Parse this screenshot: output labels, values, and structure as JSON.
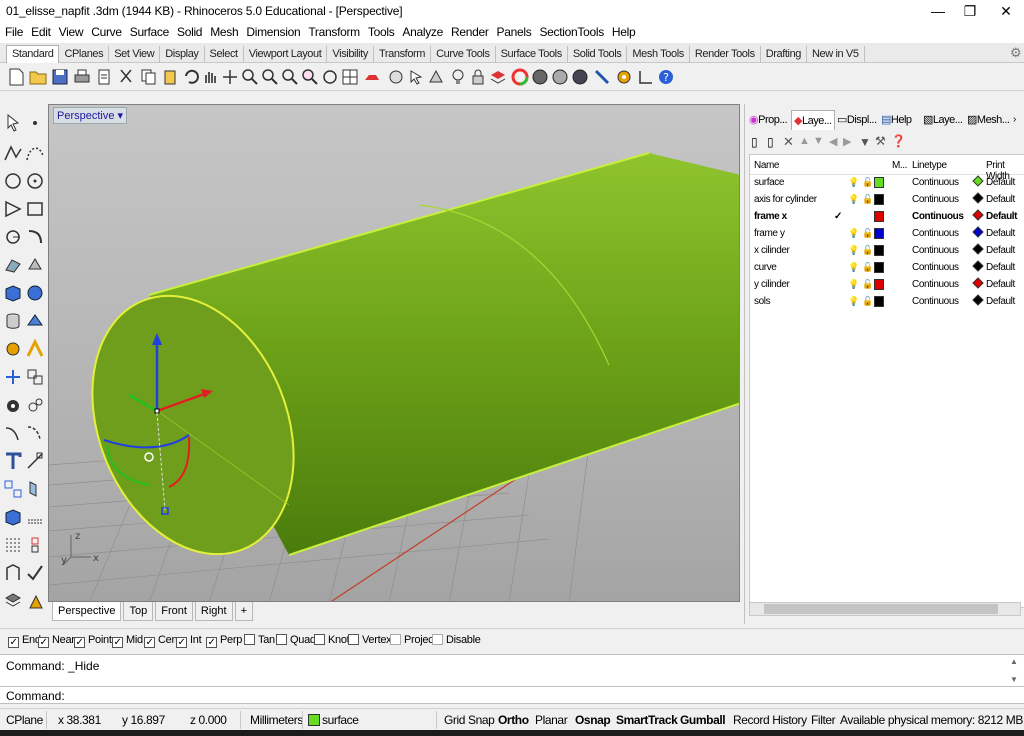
{
  "window": {
    "title": "01_elisse_napfit .3dm (1944 KB) - Rhinoceros 5.0 Educational - [Perspective]",
    "minimize": "—",
    "maximize": "❐",
    "close": "✕"
  },
  "menu": [
    "File",
    "Edit",
    "View",
    "Curve",
    "Surface",
    "Solid",
    "Mesh",
    "Dimension",
    "Transform",
    "Tools",
    "Analyze",
    "Render",
    "Panels",
    "SectionTools",
    "Help"
  ],
  "toolbar_tabs": [
    "Standard",
    "CPlanes",
    "Set View",
    "Display",
    "Select",
    "Viewport Layout",
    "Visibility",
    "Transform",
    "Curve Tools",
    "Surface Tools",
    "Solid Tools",
    "Mesh Tools",
    "Render Tools",
    "Drafting",
    "New in V5"
  ],
  "viewport": {
    "label": "Perspective",
    "label_arrow": "▾",
    "axis_x": "x",
    "axis_y": "y",
    "axis_z": "z"
  },
  "view_tabs": [
    "Perspective",
    "Top",
    "Front",
    "Right"
  ],
  "view_tab_add": "+",
  "panel": {
    "tabs": [
      "Prop...",
      "Laye...",
      "Displ...",
      "Help",
      "Laye...",
      "Mesh..."
    ],
    "columns": {
      "name": "Name",
      "material": "M...",
      "linetype": "Linetype",
      "print_width": "Print Width"
    },
    "layers": [
      {
        "name": "surface",
        "color": "#66dd22",
        "linetype": "Continuous",
        "print_width": "Default",
        "current": false
      },
      {
        "name": "axis for cylinder",
        "color": "#000000",
        "linetype": "Continuous",
        "print_width": "Default",
        "current": false
      },
      {
        "name": "frame x",
        "color": "#dd0000",
        "linetype": "Continuous",
        "print_width": "Default",
        "current": true
      },
      {
        "name": "frame y",
        "color": "#0000cc",
        "linetype": "Continuous",
        "print_width": "Default",
        "current": false
      },
      {
        "name": "x cilinder",
        "color": "#000000",
        "linetype": "Continuous",
        "print_width": "Default",
        "current": false
      },
      {
        "name": "curve",
        "color": "#000000",
        "linetype": "Continuous",
        "print_width": "Default",
        "current": false
      },
      {
        "name": "y cilinder",
        "color": "#dd0000",
        "linetype": "Continuous",
        "print_width": "Default",
        "current": false
      },
      {
        "name": "sols",
        "color": "#000000",
        "linetype": "Continuous",
        "print_width": "Default",
        "current": false
      }
    ],
    "current_mark": "✓"
  },
  "osnap": [
    {
      "label": "End",
      "checked": true
    },
    {
      "label": "Near",
      "checked": true
    },
    {
      "label": "Point",
      "checked": true
    },
    {
      "label": "Mid",
      "checked": true
    },
    {
      "label": "Cen",
      "checked": true
    },
    {
      "label": "Int",
      "checked": true
    },
    {
      "label": "Perp",
      "checked": true
    },
    {
      "label": "Tan",
      "checked": false
    },
    {
      "label": "Quad",
      "checked": false
    },
    {
      "label": "Knot",
      "checked": false
    },
    {
      "label": "Vertex",
      "checked": false
    },
    {
      "label": "Project",
      "checked": false
    },
    {
      "label": "Disable",
      "checked": false
    }
  ],
  "command": {
    "history": "Command: _Hide",
    "prompt": "Command:"
  },
  "status": {
    "cplane": "CPlane",
    "x": "x 38.381",
    "y": "y 16.897",
    "z": "z 0.000",
    "units": "Millimeters",
    "layer": "surface",
    "layer_color": "#66dd22",
    "grid_snap": "Grid Snap",
    "ortho": "Ortho",
    "planar": "Planar",
    "osnap": "Osnap",
    "smarttrack": "SmartTrack",
    "gumball": "Gumball",
    "record_history": "Record History",
    "filter": "Filter",
    "memory": "Available physical memory: 8212 MB"
  }
}
